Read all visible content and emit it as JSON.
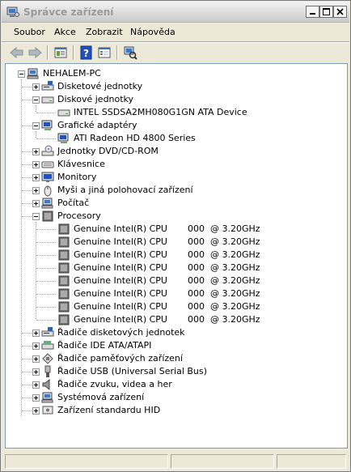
{
  "window": {
    "title": "Správce zařízení"
  },
  "menu": [
    "Soubor",
    "Akce",
    "Zobrazit",
    "Nápověda"
  ],
  "tree": {
    "root": "NEHALEM-PC",
    "categories": {
      "floppy": "Disketové jednotky",
      "disk": "Diskové jednotky",
      "disk_child": "INTEL SSDSA2MH080G1GN ATA Device",
      "display": "Grafické adaptéry",
      "display_child": "ATI Radeon HD 4800 Series",
      "dvd": "Jednotky DVD/CD-ROM",
      "keyboard": "Klávesnice",
      "monitors": "Monitory",
      "mice": "Myši a jiná polohovací zařízení",
      "computer": "Počítač",
      "processors": "Procesory",
      "floppy_ctrl": "Řadiče disketových jednotek",
      "ide": "Řadiče IDE ATA/ATAPI",
      "storage": "Řadiče paměťových zařízení",
      "usb": "Řadiče USB (Universal Serial Bus)",
      "sound": "Řadiče zvuku, videa a her",
      "system": "Systémová zařízení",
      "hid": "Zařízení standardu HID"
    },
    "cpus": [
      {
        "name": "Genuine Intel(R) CPU",
        "speed": "000  @ 3.20GHz"
      },
      {
        "name": "Genuine Intel(R) CPU",
        "speed": "000  @ 3.20GHz"
      },
      {
        "name": "Genuine Intel(R) CPU",
        "speed": "000  @ 3.20GHz"
      },
      {
        "name": "Genuine Intel(R) CPU",
        "speed": "000  @ 3.20GHz"
      },
      {
        "name": "Genuine Intel(R) CPU",
        "speed": "000  @ 3.20GHz"
      },
      {
        "name": "Genuine Intel(R) CPU",
        "speed": "000  @ 3.20GHz"
      },
      {
        "name": "Genuine Intel(R) CPU",
        "speed": "000  @ 3.20GHz"
      },
      {
        "name": "Genuine Intel(R) CPU",
        "speed": "000  @ 3.20GHz"
      }
    ]
  },
  "icons": {
    "title": "device-manager-icon",
    "toolbar": [
      "back-icon",
      "forward-icon",
      "console-tree-icon",
      "help-icon",
      "properties-icon",
      "scan-hardware-icon"
    ]
  },
  "colors": {
    "selection": "#316ac5",
    "panel_border": "#7f9db9",
    "chrome": "#ece9d8"
  }
}
